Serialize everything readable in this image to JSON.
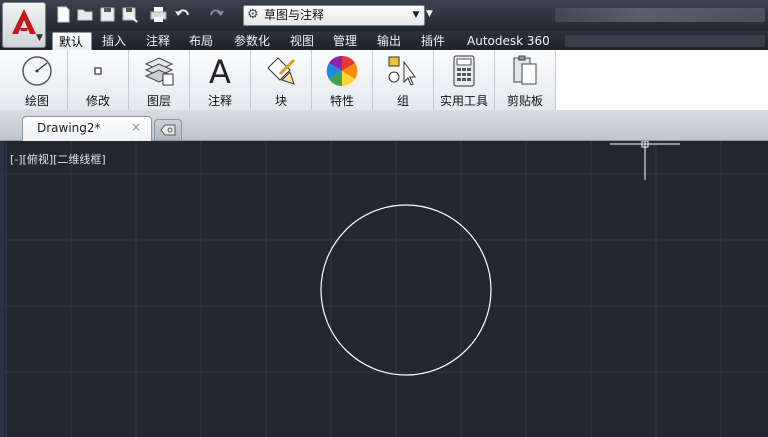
{
  "quick_access": {
    "icons": [
      "new-icon",
      "open-icon",
      "save-icon",
      "save-as-icon",
      "print-icon",
      "undo-icon",
      "redo-icon"
    ],
    "workspace": "草图与注释"
  },
  "tabs": [
    {
      "label": "默认",
      "active": true
    },
    {
      "label": "插入"
    },
    {
      "label": "注释"
    },
    {
      "label": "布局"
    },
    {
      "label": "参数化"
    },
    {
      "label": "视图"
    },
    {
      "label": "管理"
    },
    {
      "label": "输出"
    },
    {
      "label": "插件"
    },
    {
      "label": "Autodesk 360"
    }
  ],
  "ribbon": {
    "panels": [
      {
        "label": "绘图",
        "icon": "draw-circle-icon"
      },
      {
        "label": "修改",
        "icon": "modify-icon"
      },
      {
        "label": "图层",
        "icon": "layers-icon"
      },
      {
        "label": "注释",
        "icon": "annotation-icon"
      },
      {
        "label": "块",
        "icon": "block-icon"
      },
      {
        "label": "特性",
        "icon": "properties-icon"
      },
      {
        "label": "组",
        "icon": "group-icon"
      },
      {
        "label": "实用工具",
        "icon": "calculator-icon"
      },
      {
        "label": "剪贴板",
        "icon": "clipboard-icon"
      }
    ]
  },
  "document": {
    "tab_name": "Drawing2*",
    "close": "×"
  },
  "viewport": {
    "label": "[-][俯视][二维线框]",
    "background": "#212830",
    "grid_color": "#2f3743"
  }
}
